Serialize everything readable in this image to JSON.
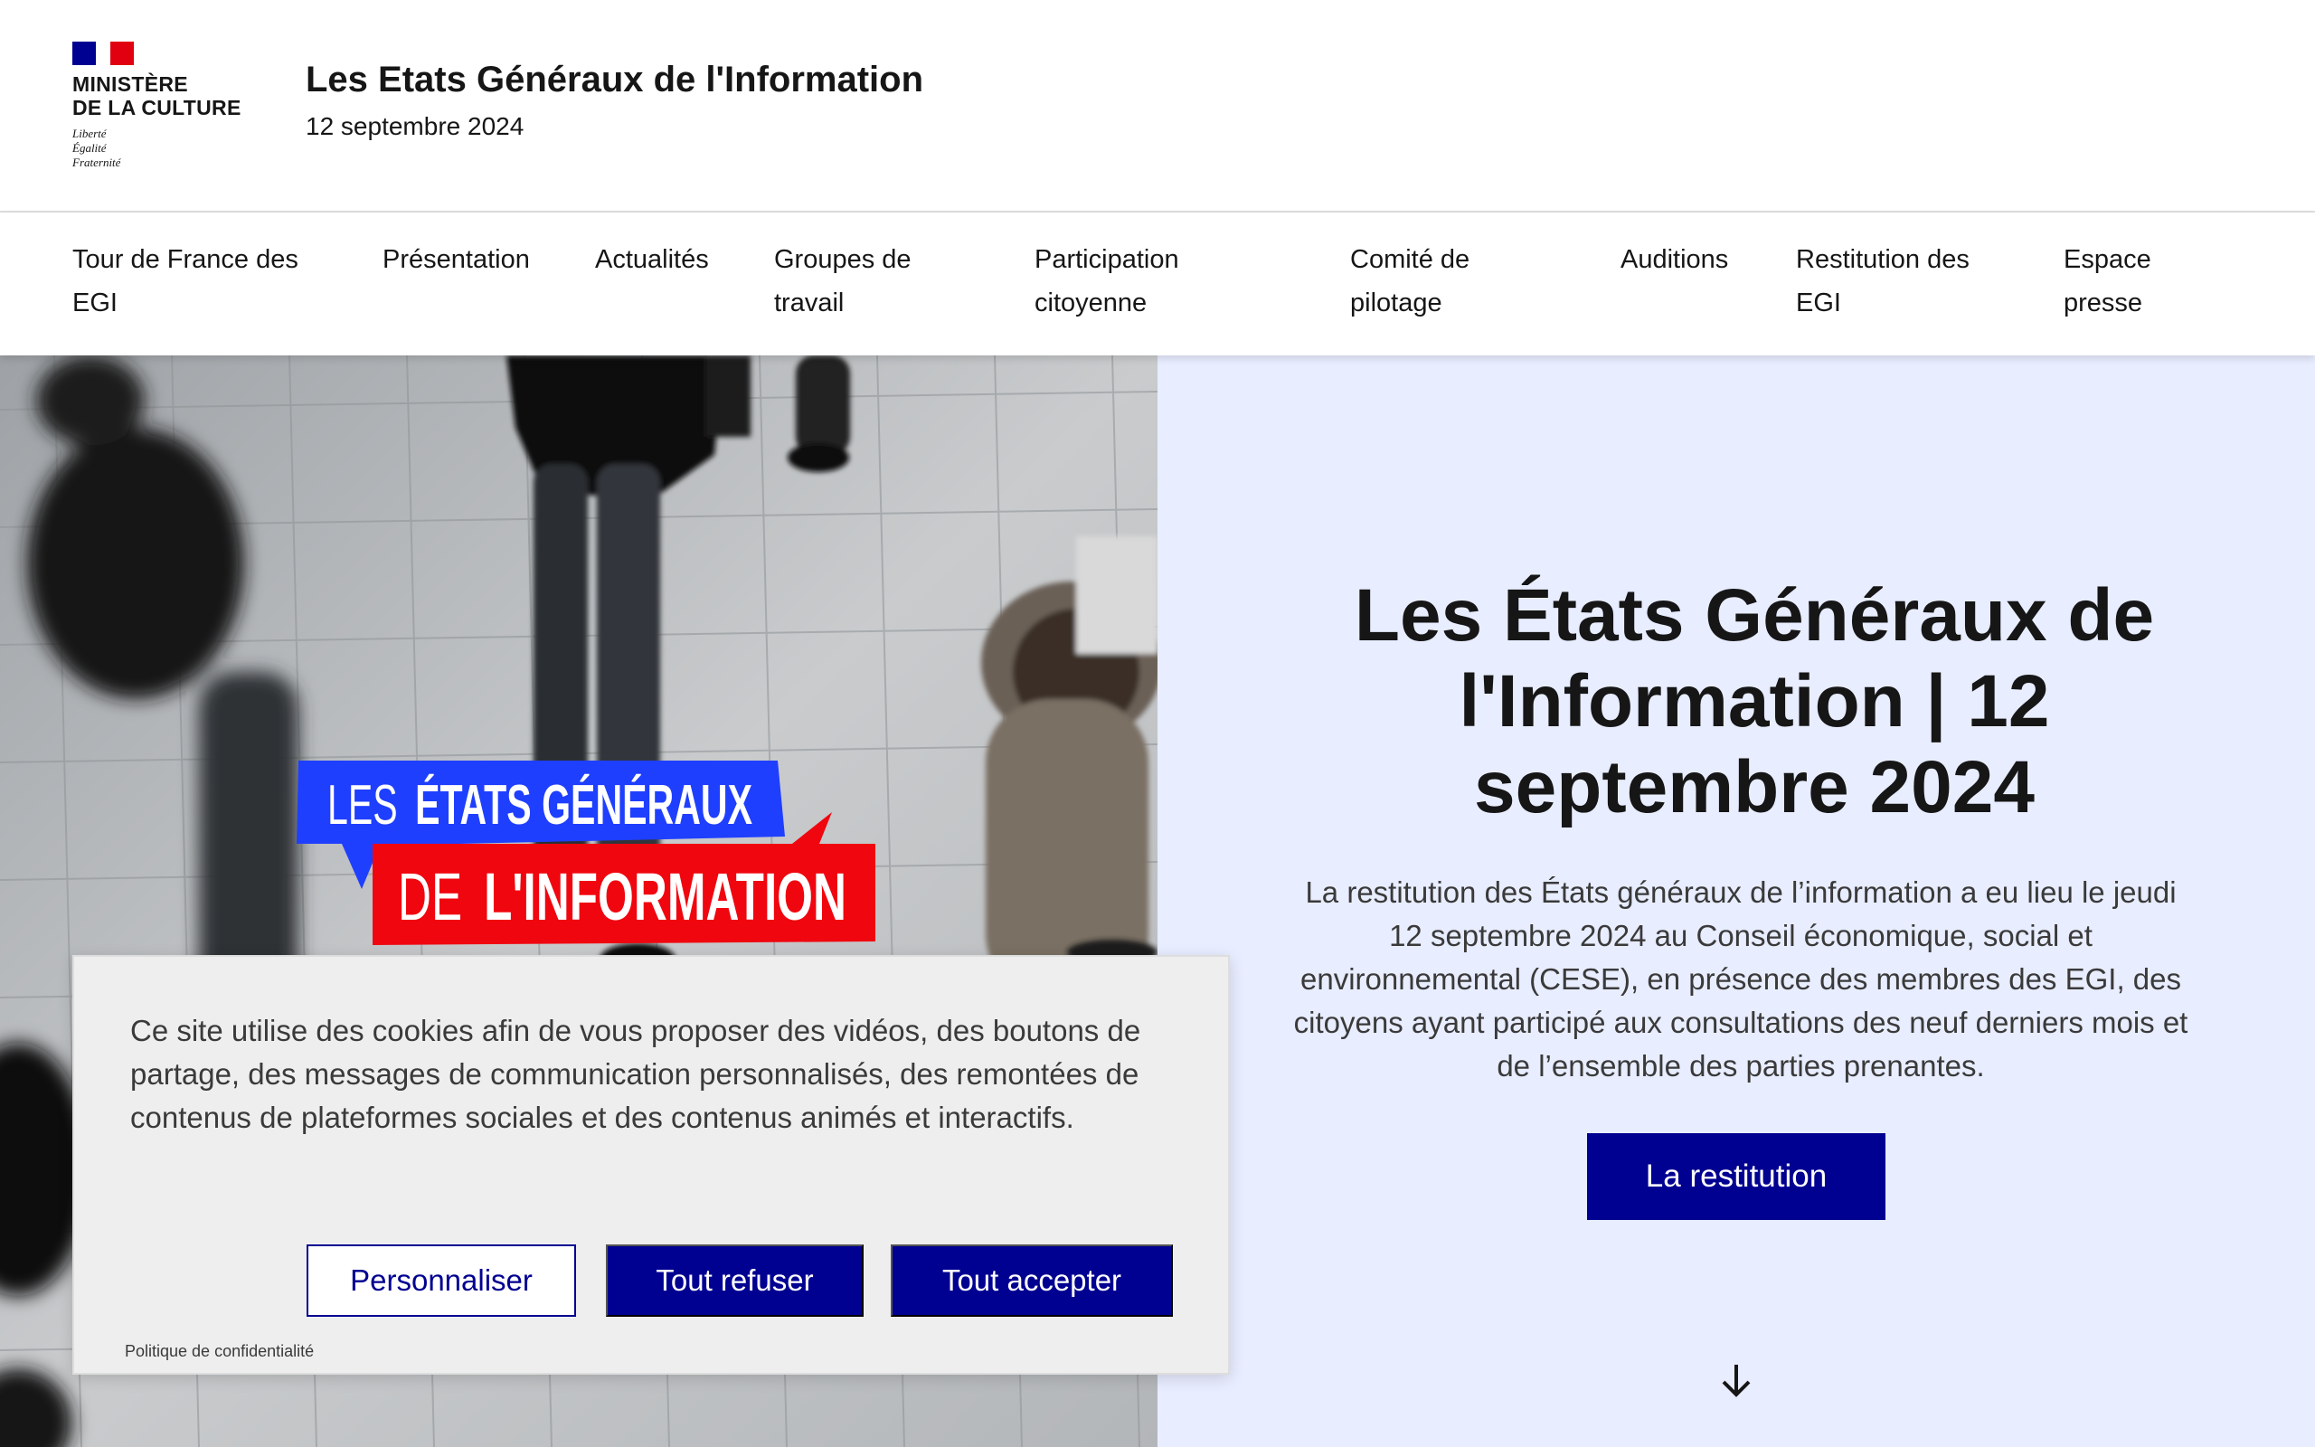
{
  "brand": {
    "logo_lines": [
      "MINISTÈRE",
      "DE LA CULTURE"
    ],
    "motto_lines": [
      "Liberté",
      "Égalité",
      "Fraternité"
    ],
    "site_title": "Les Etats Généraux de l'Information",
    "site_tagline": "12 septembre 2024"
  },
  "nav": {
    "items": [
      {
        "line1": "Tour de France des",
        "line2": "EGI"
      },
      {
        "line1": "Présentation",
        "line2": ""
      },
      {
        "line1": "Actualités",
        "line2": ""
      },
      {
        "line1": "Groupes de",
        "line2": "travail"
      },
      {
        "line1": "Participation",
        "line2": "citoyenne"
      },
      {
        "line1": "Comité de",
        "line2": "pilotage"
      },
      {
        "line1": "Auditions",
        "line2": ""
      },
      {
        "line1": "Restitution des",
        "line2": "EGI"
      },
      {
        "line1": "Espace",
        "line2": "presse"
      }
    ]
  },
  "hero": {
    "image_banner_line1_light": "LES",
    "image_banner_line1_bold": "ÉTATS GÉNÉRAUX",
    "image_banner_line2_light": "DE",
    "image_banner_line2_bold": "L'INFORMATION",
    "title_bold": "Les États Généraux de l'Information |",
    "title_regular": "12 septembre 2024",
    "description": "La restitution des États généraux de l’information a eu lieu le jeudi 12 septembre 2024 au Conseil économique, social et environnemental (CESE), en présence des membres des EGI, des citoyens ayant participé aux consultations des neuf derniers mois et de l’ensemble des parties prenantes.",
    "button_label": "La restitution",
    "scroll_icon": "arrow-down-icon"
  },
  "cookie_banner": {
    "text": "Ce site utilise des cookies afin de vous proposer des vidéos, des boutons de partage, des messages de communication personnalisés, des remontées de contenus de plateformes sociales et des contenus animés et interactifs.",
    "customize_label": "Personnaliser",
    "refuse_label": "Tout refuser",
    "accept_label": "Tout accepter",
    "privacy_link": "Politique de confidentialité"
  },
  "colors": {
    "primary": "#000091",
    "hero_bg": "#e8edff",
    "cookie_bg": "#eeeeee",
    "banner_blue": "#1f3fff",
    "banner_red": "#f0060f"
  }
}
